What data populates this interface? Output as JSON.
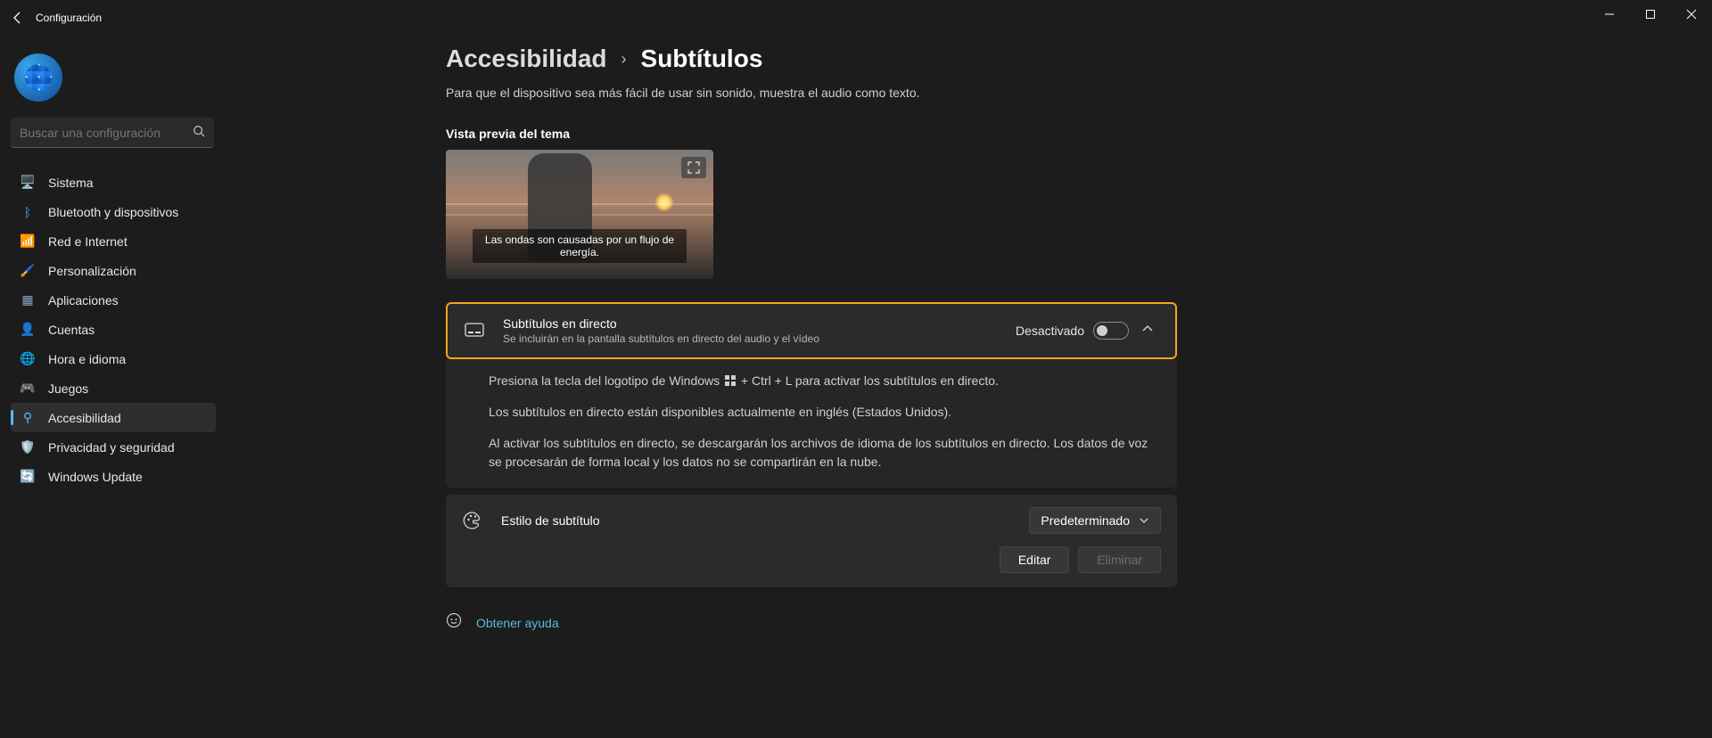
{
  "window": {
    "title": "Configuración"
  },
  "search": {
    "placeholder": "Buscar una configuración"
  },
  "sidebar": {
    "items": [
      {
        "label": "Sistema",
        "icon": "🖥️",
        "color": "#4aa6ff"
      },
      {
        "label": "Bluetooth y dispositivos",
        "icon": "ᛒ",
        "color": "#4aa6ff"
      },
      {
        "label": "Red e Internet",
        "icon": "📶",
        "color": "#35c0d2"
      },
      {
        "label": "Personalización",
        "icon": "🖌️",
        "color": "#d09060"
      },
      {
        "label": "Aplicaciones",
        "icon": "▦",
        "color": "#8aa4c4"
      },
      {
        "label": "Cuentas",
        "icon": "👤",
        "color": "#36d186"
      },
      {
        "label": "Hora e idioma",
        "icon": "🌐",
        "color": "#9bd1ff"
      },
      {
        "label": "Juegos",
        "icon": "🎮",
        "color": "#9aa0a8"
      },
      {
        "label": "Accesibilidad",
        "icon": "⚲",
        "color": "#4cc2ff",
        "active": true
      },
      {
        "label": "Privacidad y seguridad",
        "icon": "🛡️",
        "color": "#9aa0a8"
      },
      {
        "label": "Windows Update",
        "icon": "🔄",
        "color": "#2f7fe0"
      }
    ]
  },
  "breadcrumb": {
    "parent": "Accesibilidad",
    "current": "Subtítulos"
  },
  "page_subtitle": "Para que el dispositivo sea más fácil de usar sin sonido, muestra el audio como texto.",
  "preview": {
    "label": "Vista previa del tema",
    "caption": "Las ondas son causadas por un flujo de energía."
  },
  "live_captions": {
    "title": "Subtítulos en directo",
    "description": "Se incluirán en la pantalla subtítulos en directo del audio y el vídeo",
    "state": "Desactivado",
    "body_line1_prefix": "Presiona la tecla del logotipo de Windows ",
    "body_line1_suffix": " + Ctrl + L para activar los subtítulos en directo.",
    "body_line2": "Los subtítulos en directo están disponibles actualmente en inglés (Estados Unidos).",
    "body_line3": "Al activar los subtítulos en directo, se descargarán los archivos de idioma de los subtítulos en directo. Los datos de voz se procesarán de forma local y los datos no se compartirán en la nube."
  },
  "caption_style": {
    "title": "Estilo de subtítulo",
    "dropdown_value": "Predeterminado",
    "edit": "Editar",
    "delete": "Eliminar"
  },
  "help": {
    "label": "Obtener ayuda"
  }
}
